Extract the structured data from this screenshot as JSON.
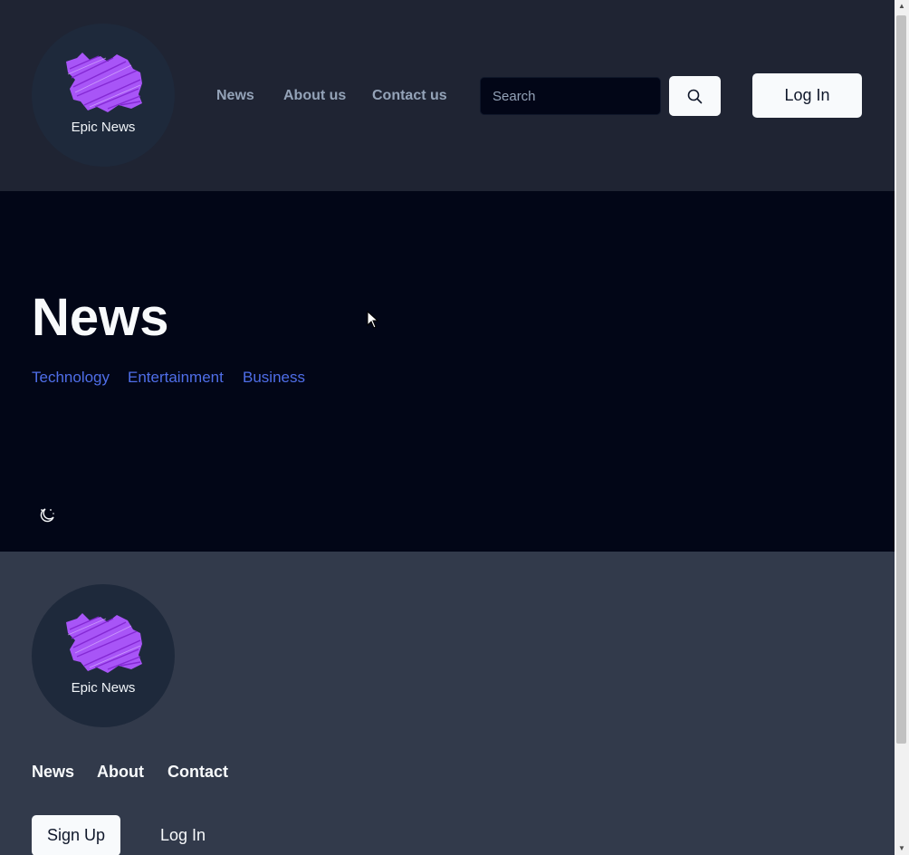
{
  "header": {
    "logo_text": "Epic News",
    "nav": [
      "News",
      "About us",
      "Contact us"
    ],
    "search_placeholder": "Search",
    "search_icon": "search-icon",
    "login_label": "Log In"
  },
  "hero": {
    "title": "News",
    "categories": [
      "Technology",
      "Entertainment",
      "Business"
    ],
    "theme_icon": "moon-icon"
  },
  "footer": {
    "logo_text": "Epic News",
    "links": [
      "News",
      "About",
      "Contact"
    ],
    "signup_label": "Sign Up",
    "login_label": "Log In"
  },
  "colors": {
    "header_bg": "#1f2433",
    "hero_bg": "#020617",
    "footer_bg": "#323a4b",
    "logo_purple": "#a855f7",
    "category_link": "#4f6ee8"
  }
}
